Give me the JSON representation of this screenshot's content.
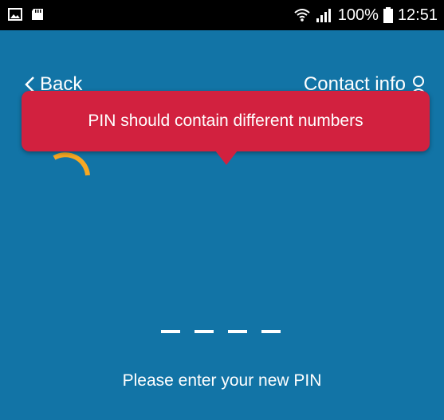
{
  "status_bar": {
    "battery_percent": "100%",
    "time": "12:51",
    "icons": [
      "gallery-icon",
      "sd-card-icon",
      "wifi-icon",
      "signal-icon",
      "battery-icon"
    ]
  },
  "header": {
    "back_label": "Back",
    "contact_label": "Contact info"
  },
  "tooltip": {
    "message": "PIN should contain different numbers",
    "color": "#d2213f"
  },
  "pin": {
    "length": 4,
    "prompt": "Please enter your new PIN"
  },
  "colors": {
    "background": "#1274a6",
    "status_bar": "#000000",
    "loader": "#f7a823"
  }
}
